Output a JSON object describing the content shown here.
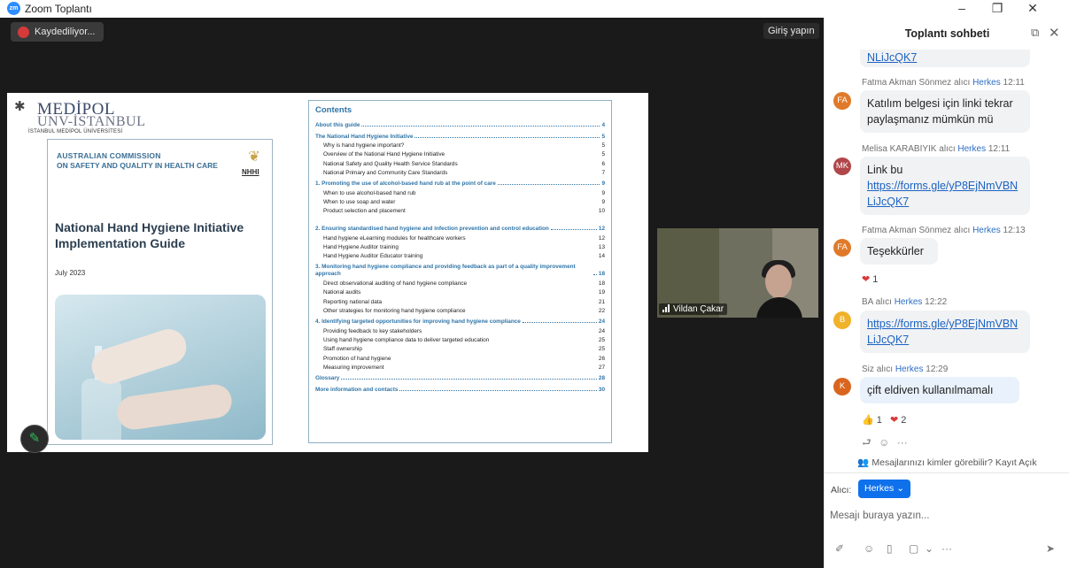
{
  "window": {
    "title": "Zoom Toplantı",
    "logo_text": "zm"
  },
  "meeting": {
    "recording_label": "Kaydediliyor...",
    "login_label": "Giriş yapın",
    "participant_name": "Vildan Çakar"
  },
  "document": {
    "university_name": "MEDİPOL",
    "university_unv": "UNV-İSTANBUL",
    "university_sub": "İSTANBUL MEDİPOL ÜNİVERSİTESİ",
    "commission_line1": "AUSTRALIAN COMMISSION",
    "commission_line2": "ON SAFETY AND QUALITY IN HEALTH CARE",
    "nhhi_label": "NHHI",
    "title": "National Hand Hygiene Initiative Implementation Guide",
    "date": "July 2023",
    "contents_title": "Contents",
    "toc": [
      {
        "text": "About this guide",
        "page": "4",
        "level": "h"
      },
      {
        "text": "The National Hand Hygiene Initiative",
        "page": "5",
        "level": "h"
      },
      {
        "text": "Why is hand hygiene important?",
        "page": "5",
        "level": "s"
      },
      {
        "text": "Overview of the National Hand Hygiene Initiative",
        "page": "5",
        "level": "s"
      },
      {
        "text": "National Safety and Quality Health Service Standards",
        "page": "6",
        "level": "s"
      },
      {
        "text": "National Primary and Community Care Standards",
        "page": "7",
        "level": "s"
      },
      {
        "text": "1. Promoting the use of alcohol-based hand rub at the point of care",
        "page": "9",
        "level": "h"
      },
      {
        "text": "When to use alcohol-based hand rub",
        "page": "9",
        "level": "s"
      },
      {
        "text": "When to use soap and water",
        "page": "9",
        "level": "s"
      },
      {
        "text": "Product selection and placement",
        "page": "10",
        "level": "s"
      },
      {
        "text": "2. Ensuring standardised hand hygiene and infection prevention and control education",
        "page": "12",
        "level": "hw"
      },
      {
        "text": "Hand hygiene eLearning modules for healthcare workers",
        "page": "12",
        "level": "s"
      },
      {
        "text": "Hand Hygiene Auditor training",
        "page": "13",
        "level": "s"
      },
      {
        "text": "Hand Hygiene Auditor Educator training",
        "page": "14",
        "level": "s"
      },
      {
        "text": "3. Monitoring hand hygiene compliance and providing feedback as part of a quality improvement approach",
        "page": "18",
        "level": "hw"
      },
      {
        "text": "Direct observational auditing of hand hygiene compliance",
        "page": "18",
        "level": "s"
      },
      {
        "text": "National audits",
        "page": "19",
        "level": "s"
      },
      {
        "text": "Reporting national data",
        "page": "21",
        "level": "s"
      },
      {
        "text": "Other strategies for monitoring hand hygiene compliance",
        "page": "22",
        "level": "s"
      },
      {
        "text": "4. Identifying targeted opportunities for improving hand hygiene compliance",
        "page": "24",
        "level": "h"
      },
      {
        "text": "Providing feedback to key stakeholders",
        "page": "24",
        "level": "s"
      },
      {
        "text": "Using hand hygiene compliance data to deliver targeted education",
        "page": "25",
        "level": "s"
      },
      {
        "text": "Staff ownership",
        "page": "25",
        "level": "s"
      },
      {
        "text": "Promotion of hand hygiene",
        "page": "26",
        "level": "s"
      },
      {
        "text": "Measuring improvement",
        "page": "27",
        "level": "s"
      },
      {
        "text": "Glossary",
        "page": "28",
        "level": "h"
      },
      {
        "text": "More information and contacts",
        "page": "30",
        "level": "h"
      }
    ]
  },
  "chat": {
    "title": "Toplantı sohbeti",
    "to_word": "alıcı",
    "audience": "Herkes",
    "top_link_tail": "NLiJcQK7",
    "messages": [
      {
        "initials": "FA",
        "avatar_color": "#e07a2a",
        "sender": "Fatma Akman Sönmez",
        "time": "12:11",
        "text": "Katılım belgesi için linki tekrar paylaşmanız mümkün mü"
      },
      {
        "initials": "MK",
        "avatar_color": "#b0464a",
        "sender": "Melisa KARABIYIK",
        "time": "12:11",
        "text": "Link bu",
        "link": "https://forms.gle/yP8EjNmVBNLiJcQK7"
      },
      {
        "initials": "FA",
        "avatar_color": "#e07a2a",
        "sender": "Fatma Akman Sönmez",
        "time": "12:13",
        "text": "Teşekkürler",
        "reaction_count": "1"
      },
      {
        "initials": "B",
        "avatar_color": "#f0b22a",
        "sender": "BA",
        "time": "12:22",
        "link": "https://forms.gle/yP8EjNmVBNLiJcQK7"
      },
      {
        "initials": "K",
        "avatar_color": "#d9651e",
        "sender": "Siz",
        "time": "12:29",
        "text": "çift eldiven kullanılmamalı",
        "thumbs_count": "1",
        "heart_count": "2"
      }
    ],
    "visibility_text": "Mesajlarınızı kimler görebilir? Kayıt Açık",
    "to_label": "Alıcı:",
    "to_button": "Herkes",
    "input_placeholder": "Mesajı buraya yazın..."
  }
}
